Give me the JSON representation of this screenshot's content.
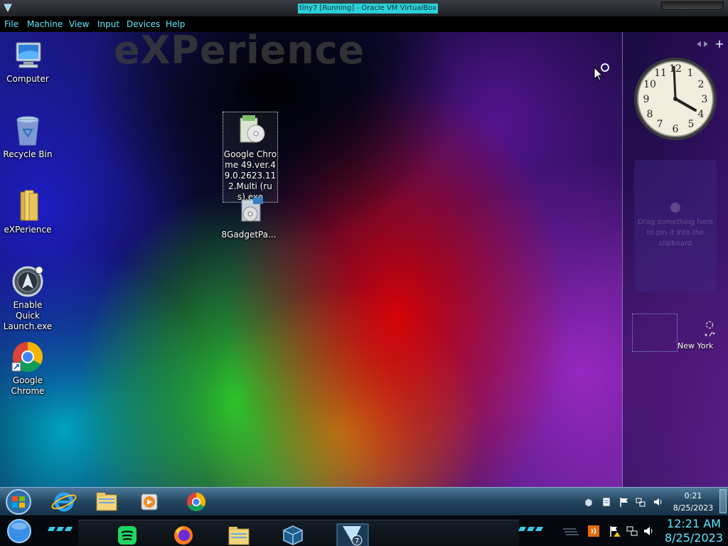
{
  "window": {
    "title": "tiny7 [Running] - Oracle VM VirtualBox"
  },
  "menubar": {
    "items": [
      "File",
      "Machine",
      "View",
      "Input",
      "Devices",
      "Help"
    ]
  },
  "wallpaper": {
    "text": "eXPerience"
  },
  "desktop_icons": [
    {
      "label": "Computer",
      "icon": "computer-icon"
    },
    {
      "label": "Recycle Bin",
      "icon": "recycle-bin-icon"
    },
    {
      "label": "eXPerience",
      "icon": "folder-icon"
    },
    {
      "label": "Enable Quick Launch.exe",
      "icon": "quick-launch-icon"
    },
    {
      "label": "Google Chrome",
      "icon": "chrome-icon"
    },
    {
      "label": "Google Chrome 49.ver.49.0.2623.112.Multi (rus).exe",
      "icon": "installer-icon"
    },
    {
      "label": "8GadgetPa...",
      "icon": "gadget-pack-icon"
    }
  ],
  "sidebar": {
    "gadget_hint": "Drag something here to pin it into the clipboard",
    "weather_city": "New York"
  },
  "taskbar": {
    "time": "0:21",
    "date": "8/25/2023",
    "pinned": [
      "internet-explorer-icon",
      "file-explorer-icon",
      "media-player-icon",
      "chrome-icon"
    ]
  },
  "host_panel": {
    "time": "12:21 AM",
    "date": "8/25/2023",
    "apps": [
      "spotify-icon",
      "firefox-icon",
      "files-icon",
      "virtualbox-icon",
      "tiny7-vm-icon"
    ]
  },
  "colors": {
    "accent_cyan": "#5fe9ff",
    "title_highlight": "#2cd0d8"
  }
}
